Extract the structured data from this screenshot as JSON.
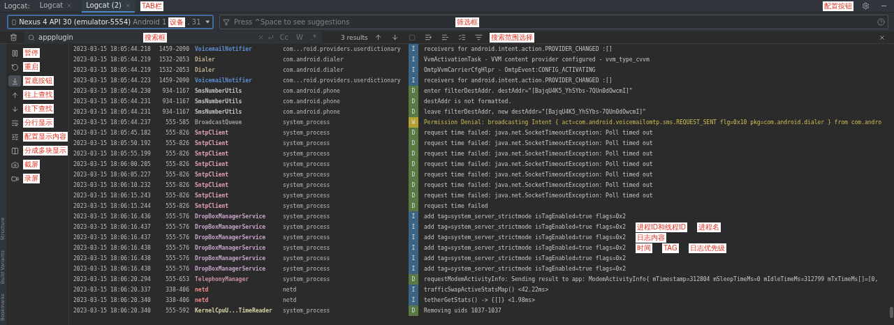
{
  "side_stripe": [
    "Structure",
    "Build Variants",
    "Bookmarks"
  ],
  "tabs_label": "Logcat:",
  "tabs": [
    {
      "label": "Logcat",
      "selected": false
    },
    {
      "label": "Logcat (2)",
      "selected": true
    }
  ],
  "tabs_annotation": "TAB栏",
  "settings_annotation": "配置按钮",
  "device": {
    "name": "Nexus 4 API 30 (emulator-5554)",
    "detail_before": "Android 1",
    "annotation": "设备",
    "detail_after": ", 31"
  },
  "filter": {
    "placeholder": "Press ^Space to see suggestions",
    "annotation": "筛选框"
  },
  "search": {
    "value": "appplugin",
    "annotation": "搜索框",
    "toggles": [
      "Cc",
      "W",
      ".*"
    ],
    "results": "3 results",
    "scope_annotation": "搜索范围选择"
  },
  "tools": [
    {
      "kind": "pause",
      "annotation": "暂停",
      "selected": false
    },
    {
      "kind": "restart",
      "annotation": "重启",
      "selected": false
    },
    {
      "kind": "scroll-end",
      "annotation": "置底按钮",
      "selected": true
    },
    {
      "kind": "up",
      "annotation": "往上查找",
      "selected": false
    },
    {
      "kind": "down",
      "annotation": "往下查找",
      "selected": false
    },
    {
      "kind": "wrap",
      "annotation": "分行显示",
      "selected": false
    },
    {
      "kind": "settings",
      "annotation": "配置显示内容",
      "selected": false
    },
    {
      "kind": "split",
      "annotation": "分成多块显示",
      "selected": false
    },
    {
      "kind": "camera",
      "annotation": "截屏",
      "selected": false
    },
    {
      "kind": "video",
      "annotation": "录屏",
      "selected": false
    }
  ],
  "logs": [
    {
      "time": "2023-03-15 18:05:44.218",
      "pid": "1459-2090",
      "tag": "VoicemailNotifier",
      "color": "#5b8ed0",
      "process": "com...roid.providers.userdictionary",
      "kind": "info",
      "priority": "I",
      "message": "receivers for android.intent.action.PROVIDER_CHANGED :[]"
    },
    {
      "time": "2023-03-15 18:05:44.219",
      "pid": "1532-2053",
      "tag": "Dialer",
      "color": "#b8a88c",
      "process": "com.android.dialer",
      "kind": "info",
      "priority": "I",
      "message": "VvmActivationTask - VVM content provider configured - vvm_type_cvvm"
    },
    {
      "time": "2023-03-15 18:05:44.219",
      "pid": "1532-2053",
      "tag": "Dialer",
      "color": "#b8a88c",
      "process": "com.android.dialer",
      "kind": "info",
      "priority": "I",
      "message": "OmtpVvmCarrierCfgHlpr - OmtpEvent:CONFIG_ACTIVATING"
    },
    {
      "time": "2023-03-15 18:05:44.223",
      "pid": "1459-2090",
      "tag": "VoicemailNotifier",
      "color": "#5b8ed0",
      "process": "com...roid.providers.userdictionary",
      "kind": "info",
      "priority": "I",
      "message": "receivers for android.intent.action.PROVIDER_CHANGED :[]"
    },
    {
      "time": "2023-03-15 18:05:44.230",
      "pid": "934-1167",
      "tag": "SmsNumberUtils",
      "color": "#c4c4c4",
      "process": "com.android.phone",
      "kind": "debug",
      "priority": "D",
      "message": "enter filterDestAddr. destAddr=\"[BajqU4K5_YhSYbs-7QUn0dOwcmI]\""
    },
    {
      "time": "2023-03-15 18:05:44.231",
      "pid": "934-1167",
      "tag": "SmsNumberUtils",
      "color": "#c4c4c4",
      "process": "com.android.phone",
      "kind": "debug",
      "priority": "D",
      "message": "destAddr is not formatted."
    },
    {
      "time": "2023-03-15 18:05:44.231",
      "pid": "934-1167",
      "tag": "SmsNumberUtils",
      "color": "#c4c4c4",
      "process": "com.android.phone",
      "kind": "debug",
      "priority": "D",
      "message": "leave filterDestAddr, new destAddr=\"[BajqU4K5_YhSYbs-7QUn0dOwcmI]\""
    },
    {
      "time": "2023-03-15 18:05:44.237",
      "pid": "555-585",
      "tag": "BroadcastQueue",
      "color": "#9a9a9a",
      "process": "system_process",
      "kind": "warn",
      "priority": "W",
      "message": "Permission Denial: broadcasting Intent { act=com.android.voicemailomtp.sms.REQUEST_SENT flg=0x10 pkg=com.android.dialer } from com.andro"
    },
    {
      "time": "2023-03-15 18:05:45.182",
      "pid": "555-826",
      "tag": "SntpClient",
      "color": "#e3a3b8",
      "process": "system_process",
      "kind": "debug",
      "priority": "D",
      "message": "request time failed: java.net.SocketTimeoutException: Poll timed out"
    },
    {
      "time": "2023-03-15 18:05:50.192",
      "pid": "555-826",
      "tag": "SntpClient",
      "color": "#e3a3b8",
      "process": "system_process",
      "kind": "debug",
      "priority": "D",
      "message": "request time failed: java.net.SocketTimeoutException: Poll timed out"
    },
    {
      "time": "2023-03-15 18:05:55.199",
      "pid": "555-826",
      "tag": "SntpClient",
      "color": "#e3a3b8",
      "process": "system_process",
      "kind": "debug",
      "priority": "D",
      "message": "request time failed: java.net.SocketTimeoutException: Poll timed out"
    },
    {
      "time": "2023-03-15 18:06:00.205",
      "pid": "555-826",
      "tag": "SntpClient",
      "color": "#e3a3b8",
      "process": "system_process",
      "kind": "debug",
      "priority": "D",
      "message": "request time failed: java.net.SocketTimeoutException: Poll timed out"
    },
    {
      "time": "2023-03-15 18:06:05.227",
      "pid": "555-826",
      "tag": "SntpClient",
      "color": "#e3a3b8",
      "process": "system_process",
      "kind": "debug",
      "priority": "D",
      "message": "request time failed: java.net.SocketTimeoutException: Poll timed out"
    },
    {
      "time": "2023-03-15 18:06:10.232",
      "pid": "555-826",
      "tag": "SntpClient",
      "color": "#e3a3b8",
      "process": "system_process",
      "kind": "debug",
      "priority": "D",
      "message": "request time failed: java.net.SocketTimeoutException: Poll timed out"
    },
    {
      "time": "2023-03-15 18:06:15.243",
      "pid": "555-826",
      "tag": "SntpClient",
      "color": "#e3a3b8",
      "process": "system_process",
      "kind": "debug",
      "priority": "D",
      "message": "request time failed: java.net.SocketTimeoutException: Poll timed out"
    },
    {
      "time": "2023-03-15 18:06:15.244",
      "pid": "555-826",
      "tag": "SntpClient",
      "color": "#e3a3b8",
      "process": "system_process",
      "kind": "debug",
      "priority": "D",
      "message": "request time failed"
    },
    {
      "time": "2023-03-15 18:06:16.436",
      "pid": "555-576",
      "tag": "DropBoxManagerService",
      "color": "#c6a2c9",
      "process": "system_process",
      "kind": "info",
      "priority": "I",
      "message": "add tag=system_server_strictmode isTagEnabled=true flags=0x2"
    },
    {
      "time": "2023-03-15 18:06:16.437",
      "pid": "555-576",
      "tag": "DropBoxManagerService",
      "color": "#c6a2c9",
      "process": "system_process",
      "kind": "info",
      "priority": "I",
      "message": "add tag=system_server_strictmode isTagEnabled=true flags=0x2",
      "annotations": [
        "进程ID和线程ID",
        "进程名"
      ]
    },
    {
      "time": "2023-03-15 18:06:16.437",
      "pid": "555-576",
      "tag": "DropBoxManagerService",
      "color": "#c6a2c9",
      "process": "system_process",
      "kind": "info",
      "priority": "I",
      "message": "add tag=system_server_strictmode isTagEnabled=true flags=0x2",
      "annotations": [
        "日志内容"
      ]
    },
    {
      "time": "2023-03-15 18:06:16.438",
      "pid": "555-576",
      "tag": "DropBoxManagerService",
      "color": "#c6a2c9",
      "process": "system_process",
      "kind": "info",
      "priority": "I",
      "message": "add tag=system_server_strictmode isTagEnabled=true flags=0x2",
      "annotations": [
        "时间",
        "TAG",
        "日志优先级"
      ]
    },
    {
      "time": "2023-03-15 18:06:16.438",
      "pid": "555-576",
      "tag": "DropBoxManagerService",
      "color": "#c6a2c9",
      "process": "system_process",
      "kind": "info",
      "priority": "I",
      "message": "add tag=system_server_strictmode isTagEnabled=true flags=0x2"
    },
    {
      "time": "2023-03-15 18:06:16.438",
      "pid": "555-576",
      "tag": "DropBoxManagerService",
      "color": "#c6a2c9",
      "process": "system_process",
      "kind": "info",
      "priority": "I",
      "message": "add tag=system_server_strictmode isTagEnabled=true flags=0x2"
    },
    {
      "time": "2023-03-15 18:06:20.294",
      "pid": "555-653",
      "tag": "TelephonyManager",
      "color": "#c98ea3",
      "process": "system_process",
      "kind": "debug",
      "priority": "D",
      "message": "requestModemActivityInfo: Sending result to app: ModemActivityInfo{ mTimestamp=312804 mSleepTimeMs=0 mIdleTimeMs=312799 mTxTimeMs[]=[0,"
    },
    {
      "time": "2023-03-15 18:06:20.337",
      "pid": "338-406",
      "tag": "netd",
      "color": "#f08c8c",
      "process": "netd",
      "kind": "info",
      "priority": "I",
      "message": "trafficSwapActiveStatsMap() <42.22ms>"
    },
    {
      "time": "2023-03-15 18:06:20.340",
      "pid": "338-406",
      "tag": "netd",
      "color": "#f08c8c",
      "process": "netd",
      "kind": "info",
      "priority": "I",
      "message": "tetherGetStats() -> {[]} <1.98ms>"
    },
    {
      "time": "2023-03-15 18:06:20.340",
      "pid": "555-592",
      "tag": "KernelCpuU...TimeReader",
      "color": "#d6d3a4",
      "process": "system_process",
      "kind": "debug",
      "priority": "D",
      "message": "Removing uids 1037-1037"
    }
  ]
}
